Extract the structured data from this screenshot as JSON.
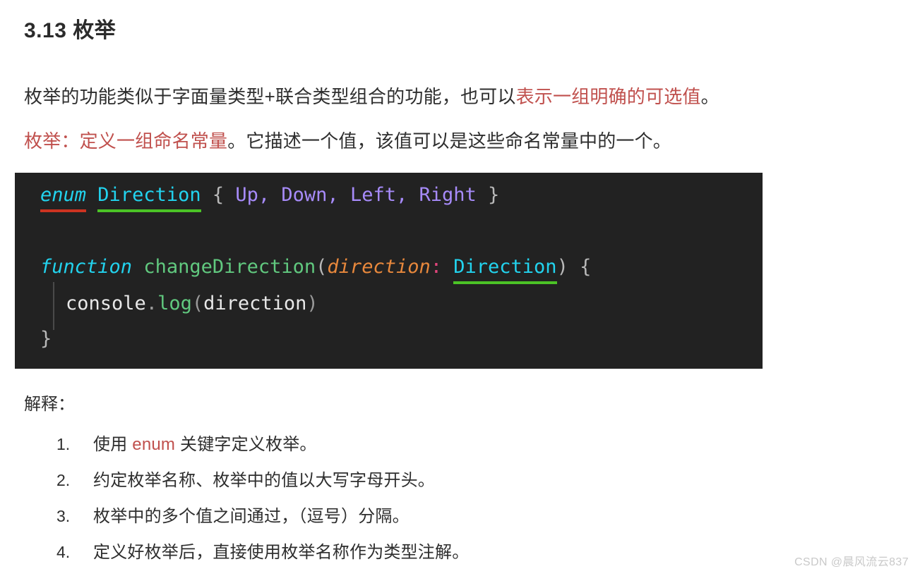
{
  "heading": "3.13 枚举",
  "paragraphs": {
    "p1_black_a": "枚举的功能类似于字面量类型+联合类型组合的功能，也可以",
    "p1_red": "表示一组明确的可选值",
    "p1_black_b": "。",
    "p2_red": "枚举：定义一组命名常量",
    "p2_black": "。它描述一个值，该值可以是这些命名常量中的一个。"
  },
  "code": {
    "line1": {
      "keyword": "enum",
      "space1": " ",
      "type": "Direction",
      "brace_open": " { ",
      "members": "Up, Down, Left, Right",
      "brace_close": " }"
    },
    "line2": {
      "keyword": "function",
      "space1": " ",
      "fn_name": "changeDirection",
      "paren_open": "(",
      "param": "direction",
      "colon": ":",
      "space2": " ",
      "type": "Direction",
      "paren_close": ")",
      "brace_open": " {"
    },
    "line3": {
      "object": "console",
      "dot": ".",
      "method": "log",
      "paren_open": "(",
      "arg": "direction",
      "paren_close": ")"
    },
    "line4": {
      "brace_close": "}"
    }
  },
  "explanation": {
    "label": "解释：",
    "items": [
      {
        "num": "1.",
        "text_a": "使用 ",
        "code": "enum",
        "text_b": " 关键字定义枚举。"
      },
      {
        "num": "2.",
        "text_a": "约定枚举名称、枚举中的值以大写字母开头。",
        "code": "",
        "text_b": ""
      },
      {
        "num": "3.",
        "text_a": "枚举中的多个值之间通过，（逗号）分隔。",
        "code": "",
        "text_b": ""
      },
      {
        "num": "4.",
        "text_a": "定义好枚举后，直接使用枚举名称作为类型注解。",
        "code": "",
        "text_b": ""
      }
    ]
  },
  "watermark": "CSDN @晨风流云837",
  "colors": {
    "accent_red": "#c0504d",
    "code_bg": "#222222",
    "type_cyan": "#22d3ee",
    "member_purple": "#a78bfa",
    "fn_green": "#61c97f",
    "param_orange": "#e8883c",
    "underline_red": "#cc3321",
    "underline_green": "#4bc326"
  }
}
